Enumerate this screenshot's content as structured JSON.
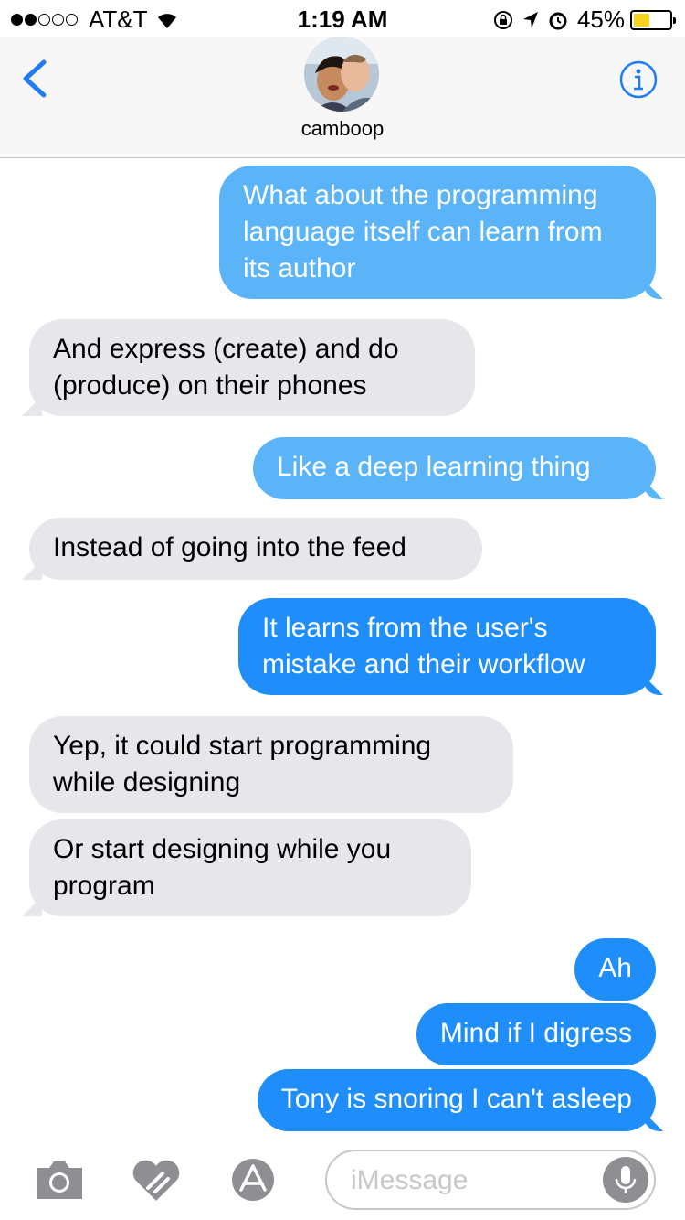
{
  "status_bar": {
    "carrier": "AT&T",
    "time": "1:19 AM",
    "battery_percent": "45%",
    "battery_level": 0.45,
    "signal_bars_filled": 2,
    "signal_bars_total": 5
  },
  "header": {
    "contact_name": "camboop"
  },
  "messages": [
    {
      "direction": "out",
      "text_lines": [
        "What about the programming",
        "language itself can learn from",
        "its author"
      ]
    },
    {
      "direction": "in",
      "text_lines": [
        "And express (create) and do",
        "(produce) on their phones"
      ]
    },
    {
      "direction": "out",
      "text_lines": [
        "Like a deep learning thing"
      ]
    },
    {
      "direction": "in",
      "text_lines": [
        "Instead of going into the feed"
      ]
    },
    {
      "direction": "out",
      "text_lines": [
        "It learns from the user's",
        "mistake and their workflow"
      ]
    },
    {
      "direction": "in",
      "text_lines": [
        "Yep, it could start programming",
        "while designing"
      ]
    },
    {
      "direction": "in",
      "text_lines": [
        "Or start designing while you",
        "program"
      ]
    },
    {
      "direction": "out",
      "text_lines": [
        "Ah"
      ]
    },
    {
      "direction": "out",
      "text_lines": [
        "Mind if I digress"
      ]
    },
    {
      "direction": "out",
      "text_lines": [
        "Tony is snoring I can't asleep"
      ]
    }
  ],
  "input_bar": {
    "placeholder": "iMessage"
  },
  "colors": {
    "outgoing_bubble": "#1f8efa",
    "outgoing_bubble_light": "#5cb4f8",
    "incoming_bubble": "#e6e6eb",
    "accent": "#1f7cf6"
  },
  "icons": [
    "back-chevron-icon",
    "info-icon",
    "camera-icon",
    "digital-touch-heart-icon",
    "app-store-icon",
    "microphone-icon",
    "wifi-icon",
    "lock-rotation-icon",
    "location-arrow-icon",
    "alarm-icon"
  ]
}
